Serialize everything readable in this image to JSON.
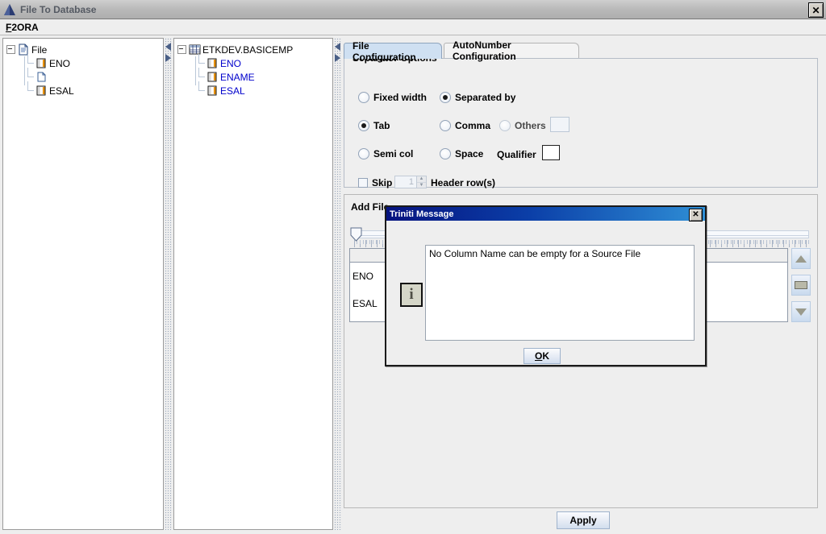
{
  "window": {
    "title": "File To Database",
    "icon": "app-triangle-icon",
    "close_label": "✕"
  },
  "menubar": {
    "items": [
      {
        "label": "F2ORA",
        "mnemonic": "F",
        "rest": "2ORA"
      }
    ]
  },
  "left_tree": {
    "root": {
      "label": "File",
      "icon": "file-document-icon",
      "expanded": true
    },
    "children": [
      {
        "label": "ENO",
        "icon": "column-icon"
      },
      {
        "label": "",
        "icon": "blank-page-icon"
      },
      {
        "label": "ESAL",
        "icon": "column-icon"
      }
    ]
  },
  "middle_tree": {
    "root": {
      "label": "ETKDEV.BASICEMP",
      "icon": "table-icon",
      "expanded": true
    },
    "children": [
      {
        "label": "ENO",
        "icon": "column-icon"
      },
      {
        "label": "ENAME",
        "icon": "column-icon"
      },
      {
        "label": "ESAL",
        "icon": "column-icon"
      }
    ]
  },
  "tabs": [
    {
      "label": "File Configuration",
      "selected": true
    },
    {
      "label": "AutoNumber Configuration",
      "selected": false
    }
  ],
  "separator_options": {
    "title": "Separator Options",
    "width_mode": [
      {
        "label": "Fixed width",
        "selected": false
      },
      {
        "label": "Separated by",
        "selected": true
      }
    ],
    "separators": [
      {
        "label": "Tab",
        "selected": true
      },
      {
        "label": "Comma",
        "selected": false
      },
      {
        "label": "Others",
        "selected": false
      },
      {
        "label": "Semi col",
        "selected": false
      },
      {
        "label": "Space",
        "selected": false
      }
    ],
    "others_value": "",
    "qualifier_label": "Qualifier",
    "qualifier_value": "",
    "skip": {
      "label": "Skip",
      "checked": false,
      "value": "1",
      "suffix_label": "Header row(s)"
    }
  },
  "file_area": {
    "add_file_label": "Add File",
    "table": {
      "rows": [
        {
          "name": "ENO"
        },
        {
          "name": "ESAL"
        }
      ]
    },
    "scrollbar": {
      "up_label": "scroll-up",
      "thumb_label": "scroll-thumb",
      "down_label": "scroll-down"
    }
  },
  "apply": {
    "label": "Apply"
  },
  "dialog": {
    "title": "Triniti Message",
    "close_label": "✕",
    "icon_glyph": "i",
    "message": "No Column Name can be empty for a Source File",
    "ok": {
      "label_prefix": "O",
      "label_rest": "K",
      "label": "OK"
    }
  },
  "colors": {
    "window_bg": "#eeeeee",
    "titlebar": "#b9b9b9",
    "dialog_title_start": "#06137f",
    "dialog_title_end": "#2f8fd6",
    "tab_selected": "#cfe0f2",
    "tree_link": "#0000cc"
  }
}
